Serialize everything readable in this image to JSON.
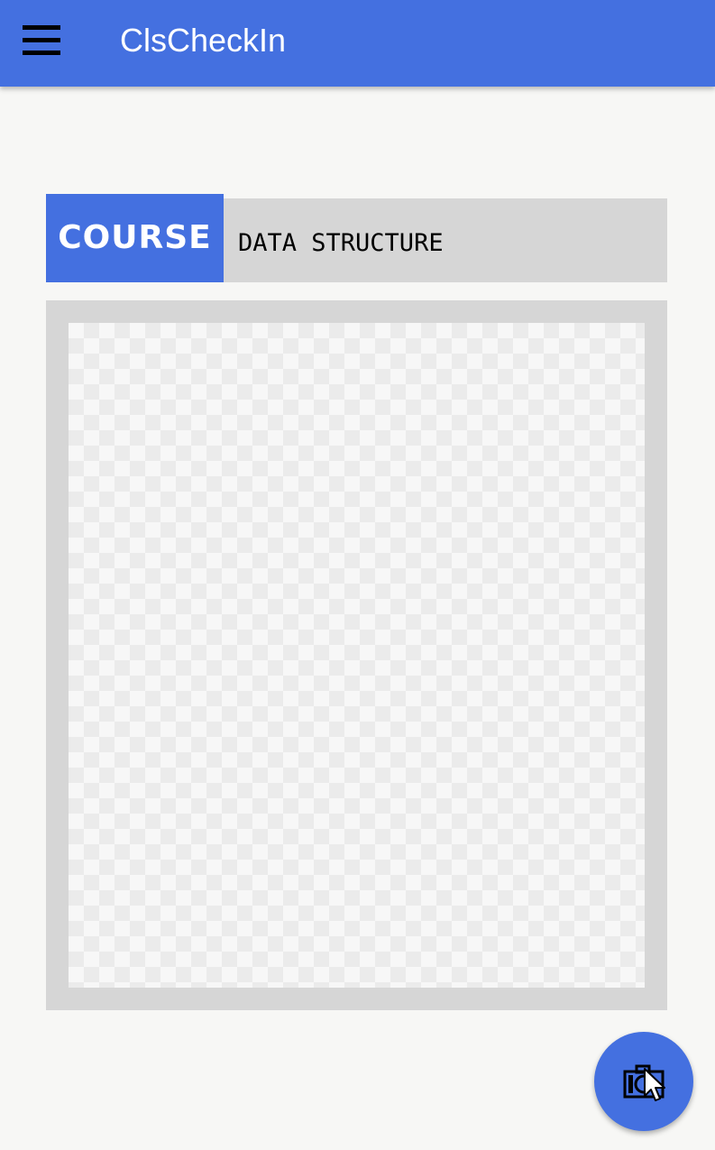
{
  "app_bar": {
    "title": "ClsCheckIn",
    "menu_icon": "hamburger-menu-icon",
    "color": "#4470e0"
  },
  "course": {
    "label": "COURSE",
    "value": "DATA STRUCTURE"
  },
  "photo_preview": {
    "state": "empty",
    "pattern": "transparency-checkerboard"
  },
  "fab": {
    "icon": "camera-icon",
    "color": "#4470e0"
  }
}
